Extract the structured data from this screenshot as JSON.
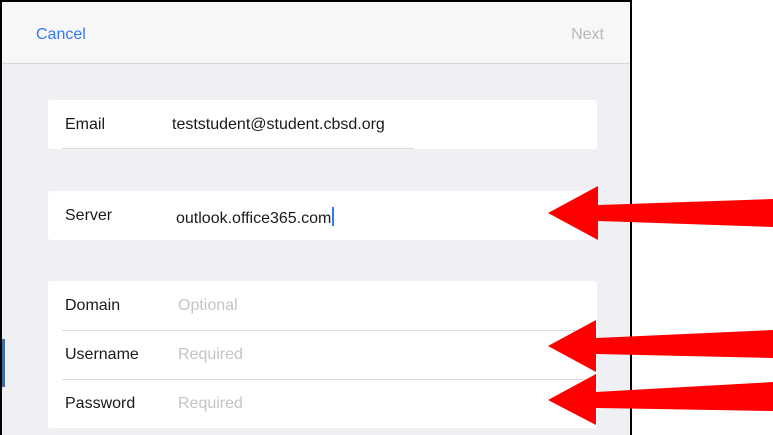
{
  "nav": {
    "cancel_label": "Cancel",
    "next_label": "Next"
  },
  "fields": {
    "email": {
      "label": "Email",
      "value": "teststudent@student.cbsd.org"
    },
    "server": {
      "label": "Server",
      "value": "outlook.office365.com"
    },
    "domain": {
      "label": "Domain",
      "placeholder": "Optional"
    },
    "username": {
      "label": "Username",
      "placeholder": "Required"
    },
    "password": {
      "label": "Password",
      "placeholder": "Required"
    }
  },
  "colors": {
    "accent": "#3478f6",
    "arrow": "#ff0000",
    "background": "#efeff4",
    "placeholder": "#c4c4c8"
  },
  "annotations": {
    "arrows": [
      "server-arrow",
      "username-arrow",
      "password-arrow"
    ]
  }
}
